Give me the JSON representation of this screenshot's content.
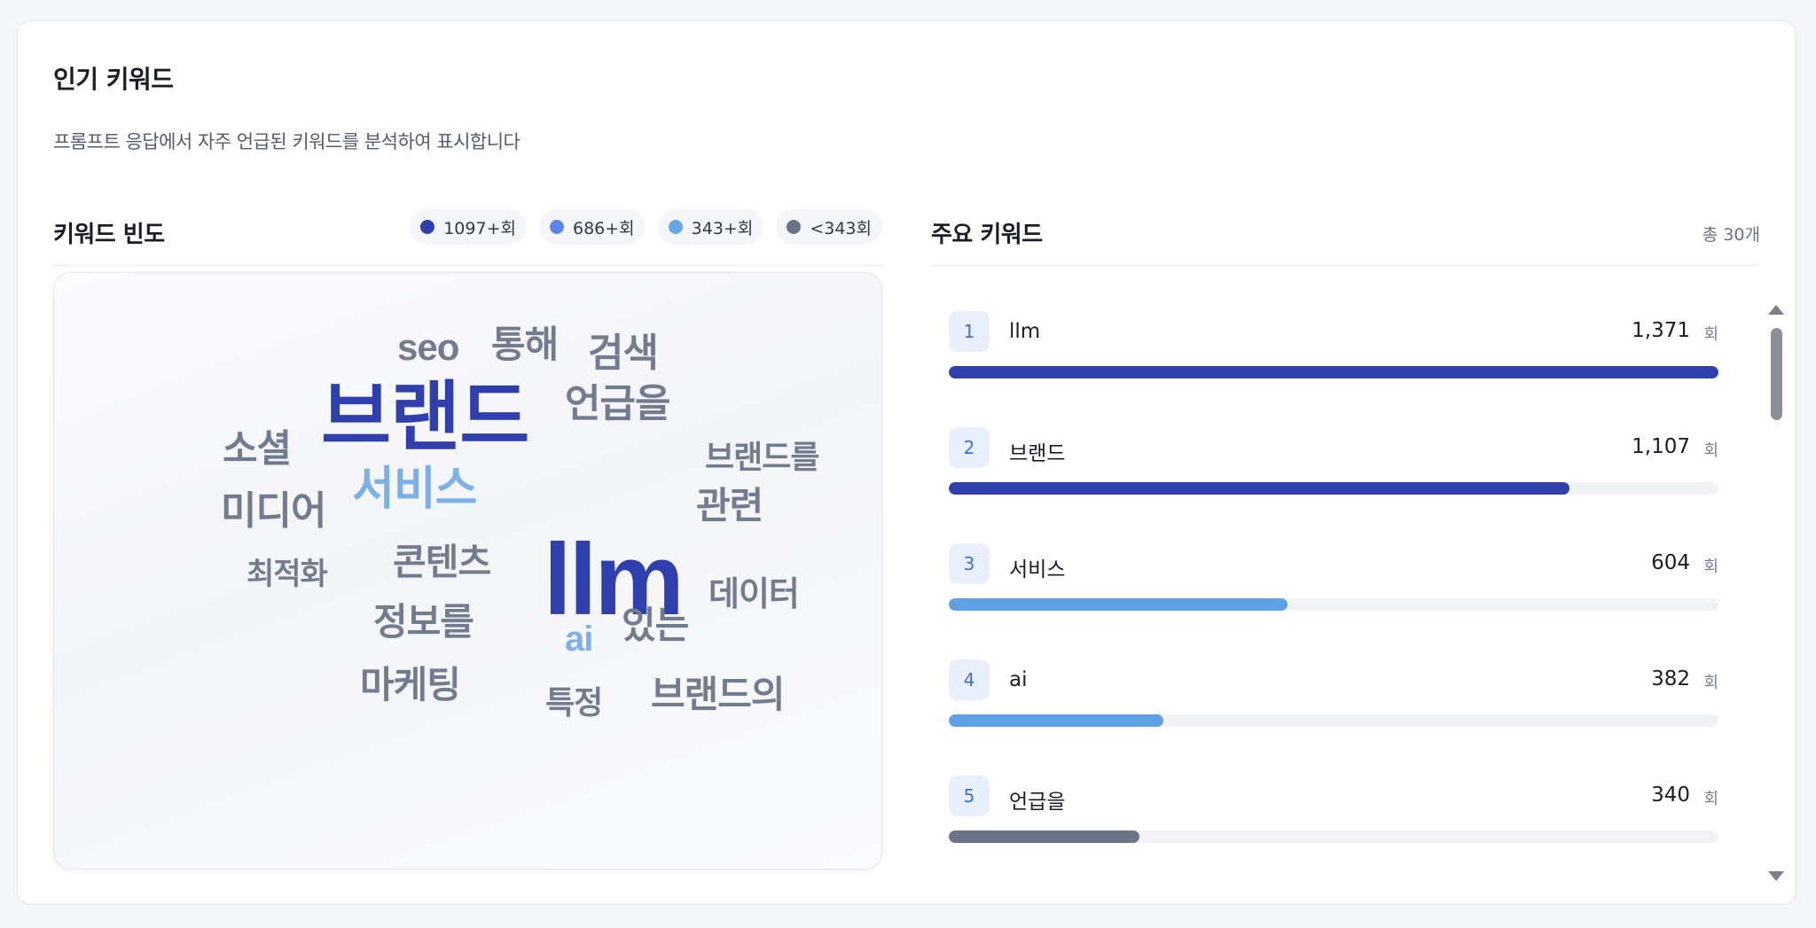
{
  "header": {
    "title": "인기 키워드",
    "subtitle": "프롬프트 응답에서 자주 언급된 키워드를 분석하여 표시합니다"
  },
  "frequency": {
    "title": "키워드 빈도",
    "legend": [
      {
        "label": "1097+회",
        "color": "#2f3fae"
      },
      {
        "label": "686+회",
        "color": "#5b87ea"
      },
      {
        "label": "343+회",
        "color": "#67a6e6"
      },
      {
        "label": "<343회",
        "color": "#6b7386"
      }
    ]
  },
  "cloud": {
    "colors": {
      "tier1": "#2f3fae",
      "tier3": "#7db0e8",
      "tier4": "#737b8f"
    },
    "words": {
      "w_seo": "seo",
      "w_tonghae": "통해",
      "w_geomsaek": "검색",
      "w_brand": "브랜드",
      "w_eongeup": "언급을",
      "w_social": "소셜",
      "w_brandreul": "브랜드를",
      "w_service": "서비스",
      "w_media": "미디어",
      "w_llm": "llm",
      "w_gwallyeon": "관련",
      "w_content": "콘텐츠",
      "w_choejeok": "최적화",
      "w_data": "데이터",
      "w_jeongbo": "정보를",
      "w_ai": "ai",
      "w_itneun": "있는",
      "w_marketing": "마케팅",
      "w_teukjeong": "특정",
      "w_brandui": "브랜드의"
    }
  },
  "top_keywords": {
    "title": "주요 키워드",
    "total": "총 30개",
    "unit": "회",
    "items": [
      {
        "rank": "1",
        "name": "llm",
        "count": "1,371",
        "share": 1.0,
        "color": "#2f3fae"
      },
      {
        "rank": "2",
        "name": "브랜드",
        "count": "1,107",
        "share": 0.807,
        "color": "#2f3fae"
      },
      {
        "rank": "3",
        "name": "서비스",
        "count": "604",
        "share": 0.44,
        "color": "#5ea0e4"
      },
      {
        "rank": "4",
        "name": "ai",
        "count": "382",
        "share": 0.279,
        "color": "#5ea0e4"
      },
      {
        "rank": "5",
        "name": "언급을",
        "count": "340",
        "share": 0.248,
        "color": "#6b7386"
      }
    ]
  }
}
